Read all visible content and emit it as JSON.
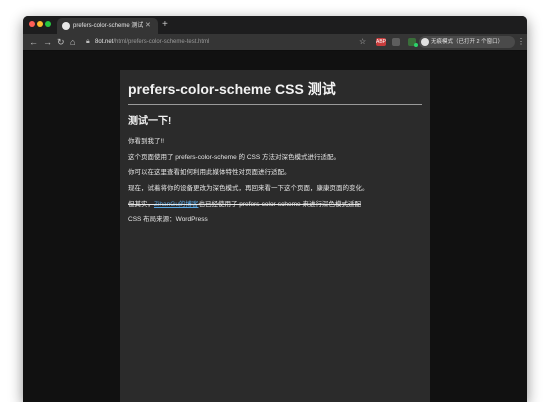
{
  "browser": {
    "tab": {
      "title": "prefers-color-scheme 测试 - …"
    },
    "address": {
      "host": "8ot.net",
      "path": "/html/prefers-color-scheme-test.html"
    },
    "extension_label": "ABP",
    "profile_label": "无痕模式（已打开 2 个窗口）"
  },
  "page": {
    "title": "prefers-color-scheme CSS 测试",
    "subtitle": "测试一下!",
    "paragraphs": {
      "p1": "你看到我了!!",
      "p2": "这个页面使用了 prefers-color-scheme 的 CSS 方法对深色模式进行适配。",
      "p3": "你可以在这里查看如何利用此媒体特性对页面进行适配。",
      "p4": "现在，试着将你的设备更改为深色模式，再回来看一下这个页面，康康页面的变化。"
    },
    "note": {
      "before": "但其实，",
      "link": "ZihanGu的博客",
      "after": "也已经使用了 prefers-color-scheme 来进行深色模式适配"
    },
    "credit": "CSS 布局来源：WordPress"
  }
}
